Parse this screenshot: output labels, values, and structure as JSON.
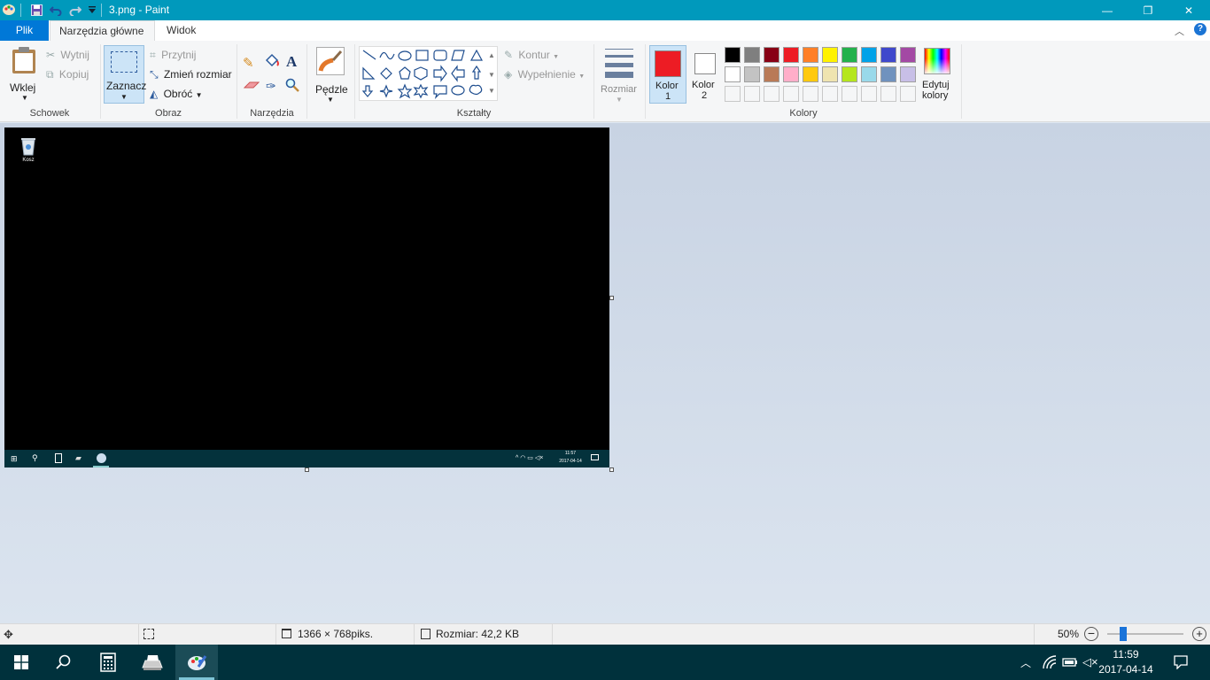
{
  "titlebar": {
    "title": "3.png - Paint",
    "qa_icons": [
      "paint-app-icon",
      "save-icon",
      "undo-icon",
      "redo-icon",
      "customize-icon"
    ],
    "minimize": "—",
    "restore": "❐",
    "close": "✕",
    "accent": "#0099bc"
  },
  "tabs": {
    "file": "Plik",
    "home": "Narzędzia główne",
    "view": "Widok"
  },
  "ribbon": {
    "clipboard": {
      "paste": "Wklej",
      "cut": "Wytnij",
      "copy": "Kopiuj",
      "label": "Schowek"
    },
    "image": {
      "select": "Zaznacz",
      "crop": "Przytnij",
      "resize": "Zmień rozmiar",
      "rotate": "Obróć",
      "label": "Obraz"
    },
    "tools": {
      "label": "Narzędzia"
    },
    "brushes": {
      "label": "Pędzle"
    },
    "shapes": {
      "outline": "Kontur",
      "fill": "Wypełnienie",
      "label": "Kształty"
    },
    "size": {
      "label": "Rozmiar"
    },
    "colors": {
      "color1_line1": "Kolor",
      "color1_line2": "1",
      "color2_line1": "Kolor",
      "color2_line2": "2",
      "edit_line1": "Edytuj",
      "edit_line2": "kolory",
      "label": "Kolory",
      "color1": "#ed1c24",
      "color2": "#ffffff",
      "row1": [
        "#000000",
        "#7f7f7f",
        "#880015",
        "#ed1c24",
        "#ff7f27",
        "#fff200",
        "#22b14c",
        "#00a2e8",
        "#3f48cc",
        "#a349a4"
      ],
      "row2": [
        "#ffffff",
        "#c3c3c3",
        "#b97a57",
        "#ffaec9",
        "#ffc90e",
        "#efe4b0",
        "#b5e61d",
        "#99d9ea",
        "#7092be",
        "#c8bfe7"
      ]
    }
  },
  "canvas_image": {
    "recycle_label": "Kosz",
    "clock_time": "11:57",
    "clock_date": "2017-04-14"
  },
  "statusbar": {
    "dimensions": "1366 × 768piks.",
    "filesize": "Rozmiar: 42,2 KB",
    "zoom": "50%",
    "zoom_level": 0.5
  },
  "taskbar": {
    "time": "11:59",
    "date": "2017-04-14",
    "apps": [
      "start-icon",
      "search-icon",
      "calculator-icon",
      "printer-icon",
      "paint-icon"
    ]
  }
}
